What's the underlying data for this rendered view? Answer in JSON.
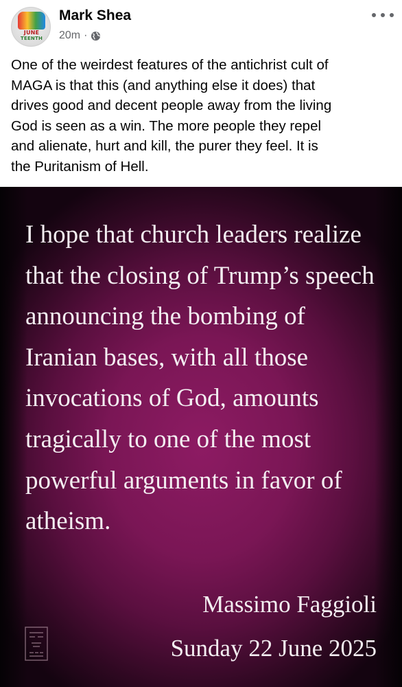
{
  "post": {
    "author": "Mark Shea",
    "timestamp": "20m",
    "separator": "·",
    "audience_icon": "globe-icon",
    "more_icon": "more-options-icon",
    "text": "One of the weirdest features of the antichrist cult of\nMAGA is that this (and anything else it does) that\ndrives good and decent people away from the living\nGod is seen as a win.  The more people they repel\nand alienate, hurt and kill, the purer they feel.  It is\nthe Puritanism of Hell."
  },
  "avatar": {
    "logo_line1": "JUNE",
    "logo_line2": "TEENTH"
  },
  "image": {
    "quote": "I hope that church leaders realize\nthat the closing of Trump’s speech\nannouncing the bombing of\nIranian bases, with all those\ninvocations of God, amounts\ntragically to one of the most\npowerful arguments in favor of\natheism.",
    "author": "Massimo Faggioli",
    "date": "Sunday 22 June 2025",
    "background_color": "#7a1655"
  }
}
